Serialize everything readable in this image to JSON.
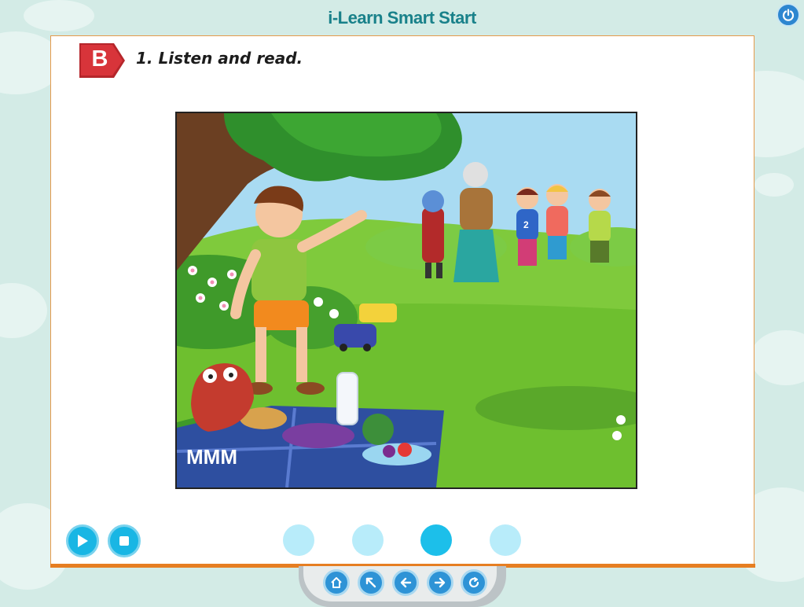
{
  "app": {
    "title": "i-Learn Smart Start"
  },
  "icons": {
    "power": "power-icon",
    "play": "play-icon",
    "stop": "stop-icon",
    "home": "home-icon",
    "menu": "menu-arrow-icon",
    "back": "arrow-left-icon",
    "next": "arrow-right-icon",
    "replay": "replay-icon"
  },
  "colors": {
    "accent": "#19b6e4",
    "title": "#19818a",
    "badge": "#d8343a",
    "panel_border": "#e67e22",
    "nav": "#2e93d6"
  },
  "lesson": {
    "section_letter": "B",
    "instruction": "1. Listen and read."
  },
  "illustration": {
    "sound_text": "MMM",
    "jersey_number": "2"
  },
  "pagination": {
    "pages": 4,
    "current": 3
  }
}
